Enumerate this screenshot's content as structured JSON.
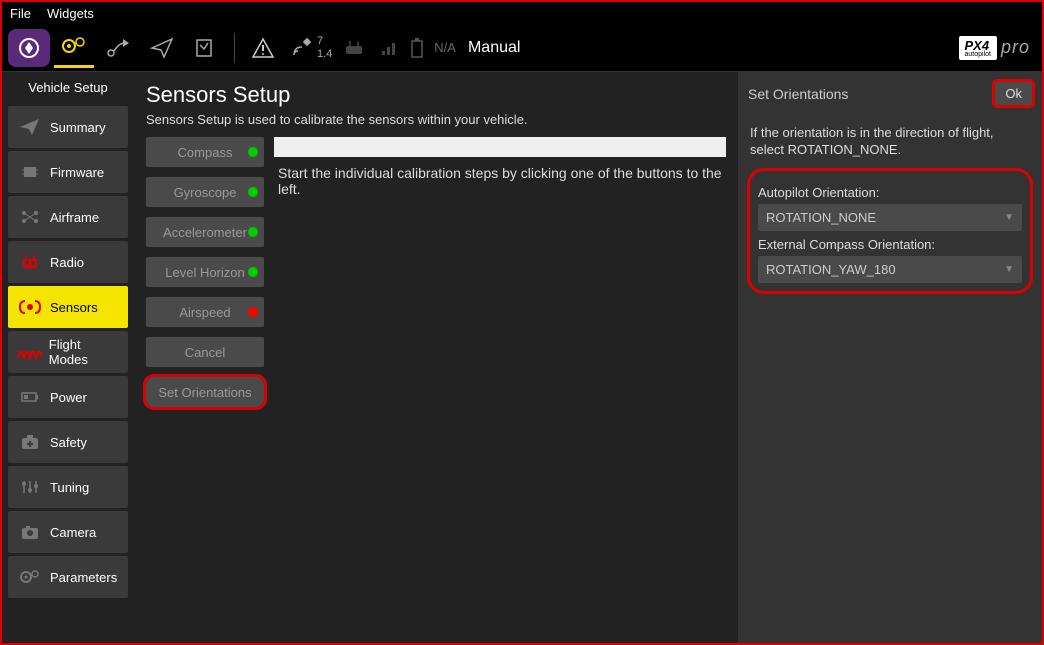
{
  "menu": {
    "file": "File",
    "widgets": "Widgets"
  },
  "toolbar": {
    "num_top": "7",
    "num_bot": "1.4",
    "na": "N/A",
    "mode": "Manual",
    "brand": "PX4",
    "brand_sub": "autopilot",
    "brand_pro": "pro"
  },
  "sidebar": {
    "title": "Vehicle Setup",
    "items": [
      {
        "label": "Summary"
      },
      {
        "label": "Firmware"
      },
      {
        "label": "Airframe"
      },
      {
        "label": "Radio"
      },
      {
        "label": "Sensors"
      },
      {
        "label": "Flight Modes"
      },
      {
        "label": "Power"
      },
      {
        "label": "Safety"
      },
      {
        "label": "Tuning"
      },
      {
        "label": "Camera"
      },
      {
        "label": "Parameters"
      }
    ]
  },
  "page": {
    "title": "Sensors Setup",
    "desc": "Sensors Setup is used to calibrate the sensors within your vehicle.",
    "instr": "Start the individual calibration steps by clicking one of the buttons to the left."
  },
  "cal": {
    "compass": "Compass",
    "gyro": "Gyroscope",
    "accel": "Accelerometer",
    "level": "Level Horizon",
    "airspeed": "Airspeed",
    "cancel": "Cancel",
    "setorient": "Set Orientations"
  },
  "panel": {
    "title": "Set Orientations",
    "ok": "Ok",
    "note": "If the orientation is in the direction of flight, select ROTATION_NONE.",
    "autopilot_label": "Autopilot Orientation:",
    "autopilot_value": "ROTATION_NONE",
    "compass_label": "External Compass Orientation:",
    "compass_value": "ROTATION_YAW_180"
  }
}
